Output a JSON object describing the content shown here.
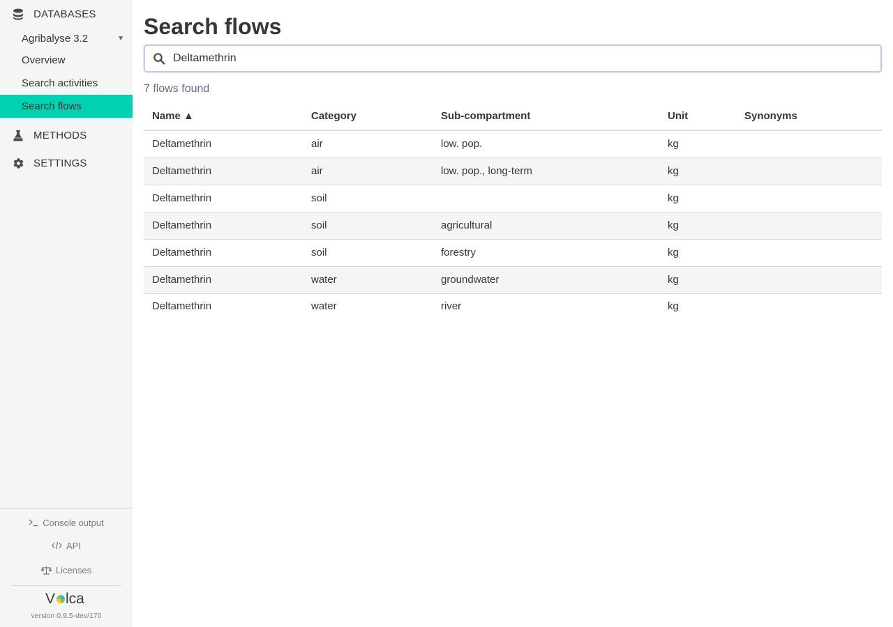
{
  "sidebar": {
    "databases_label": "DATABASES",
    "db_selected": "Agribalyse 3.2",
    "db_items": [
      {
        "label": "Overview"
      },
      {
        "label": "Search activities"
      },
      {
        "label": "Search flows"
      }
    ],
    "methods_label": "METHODS",
    "settings_label": "SETTINGS",
    "active_color": "#00d1b2"
  },
  "footer": {
    "console_label": "Console output",
    "api_label": "API",
    "licenses_label": "Licenses",
    "logo_text": "Volca",
    "version": "version 0.9.5-dev/170"
  },
  "main": {
    "title": "Search flows",
    "search": {
      "value": "Deltamethrin",
      "icon": "search-icon"
    },
    "result_count": "7 flows found",
    "columns": [
      "Name ▲",
      "Category",
      "Sub-compartment",
      "Unit",
      "Synonyms"
    ],
    "rows": [
      {
        "name": "Deltamethrin",
        "category": "air",
        "sub": "low. pop.",
        "unit": "kg",
        "synonyms": ""
      },
      {
        "name": "Deltamethrin",
        "category": "air",
        "sub": "low. pop., long-term",
        "unit": "kg",
        "synonyms": ""
      },
      {
        "name": "Deltamethrin",
        "category": "soil",
        "sub": "",
        "unit": "kg",
        "synonyms": ""
      },
      {
        "name": "Deltamethrin",
        "category": "soil",
        "sub": "agricultural",
        "unit": "kg",
        "synonyms": ""
      },
      {
        "name": "Deltamethrin",
        "category": "soil",
        "sub": "forestry",
        "unit": "kg",
        "synonyms": ""
      },
      {
        "name": "Deltamethrin",
        "category": "water",
        "sub": "groundwater",
        "unit": "kg",
        "synonyms": ""
      },
      {
        "name": "Deltamethrin",
        "category": "water",
        "sub": "river",
        "unit": "kg",
        "synonyms": ""
      }
    ]
  }
}
